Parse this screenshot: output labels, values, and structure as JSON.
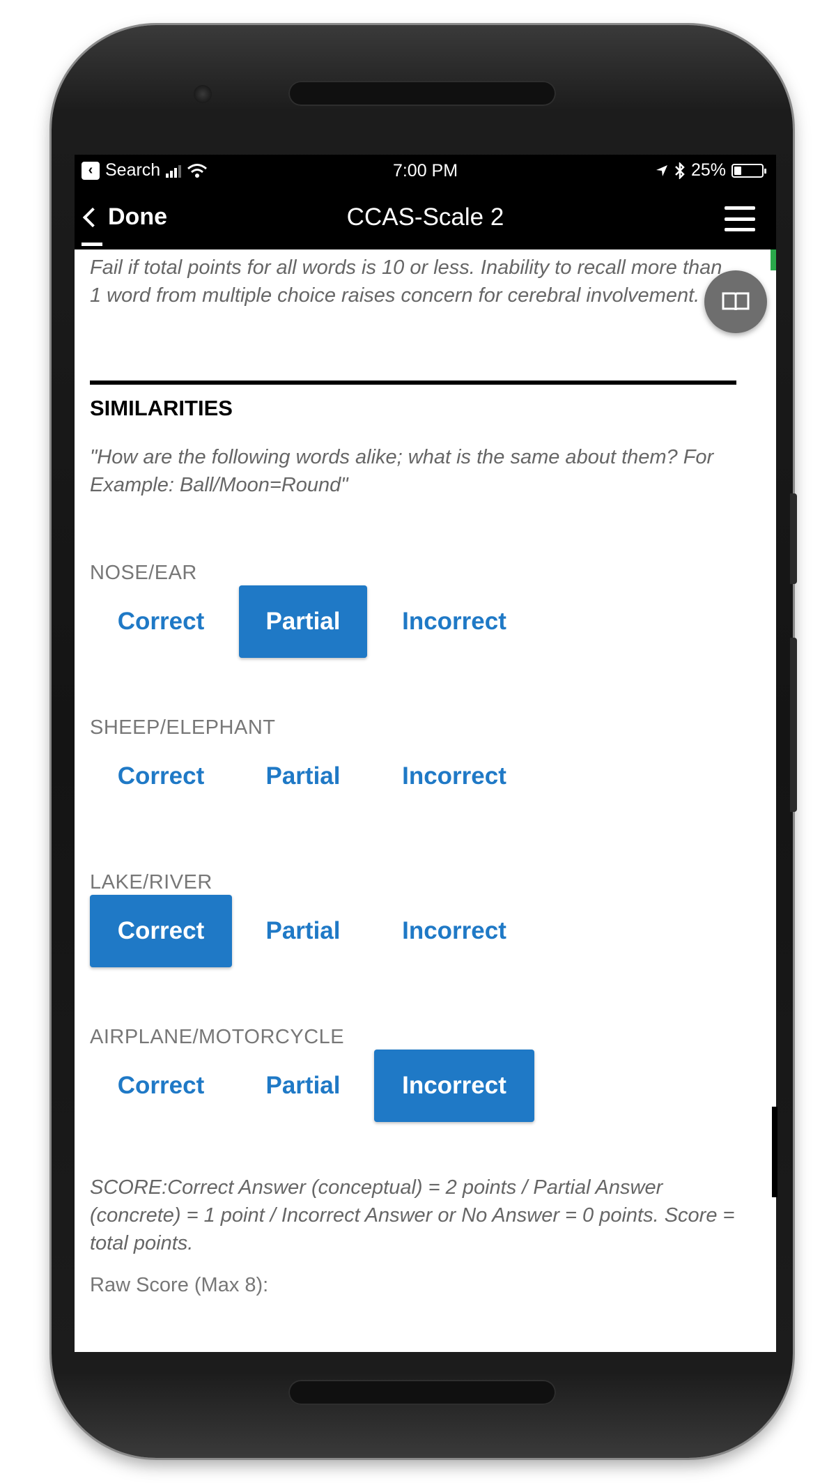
{
  "status_bar": {
    "back_app": "Search",
    "time": "7:00 PM",
    "battery": "25%",
    "battery_level": 0.25
  },
  "nav": {
    "back_label": "Done",
    "title": "CCAS-Scale 2"
  },
  "fail_note": "Fail if total points for all words is 10 or less. Inability to recall more than 1 word from multiple choice raises concern for cerebral involvement.",
  "section": {
    "title": "SIMILARITIES",
    "instruction": "\"How are the following words alike; what is the same about them?  For Example: Ball/Moon=Round\""
  },
  "options": {
    "correct": "Correct",
    "partial": "Partial",
    "incorrect": "Incorrect"
  },
  "items": [
    {
      "label": "NOSE/EAR",
      "selected": "partial"
    },
    {
      "label": "SHEEP/ELEPHANT",
      "selected": ""
    },
    {
      "label": "LAKE/RIVER",
      "selected": "correct"
    },
    {
      "label": "AIRPLANE/MOTORCYCLE",
      "selected": "incorrect"
    }
  ],
  "score_note": "SCORE:Correct Answer (conceptual) = 2 points / Partial Answer (concrete) = 1 point / Incorrect Answer or No Answer = 0 points. Score = total points.",
  "raw_score_label": "Raw Score (Max 8):",
  "colors": {
    "accent": "#1f79c6",
    "nav_bg": "#000000",
    "muted_text": "#666666"
  },
  "icons": {
    "float_button": "book-icon",
    "menu": "hamburger-icon",
    "back": "chevron-left-icon"
  }
}
